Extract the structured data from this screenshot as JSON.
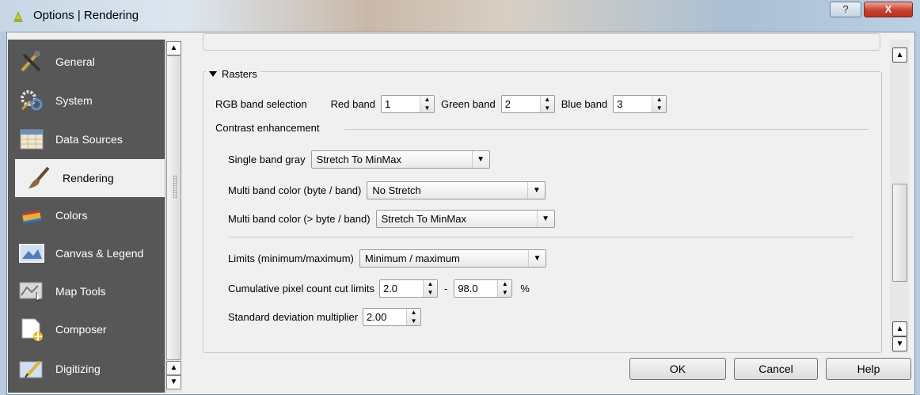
{
  "window": {
    "title": "Options | Rendering",
    "help_glyph": "?",
    "close_glyph": "X"
  },
  "sidebar": {
    "items": [
      {
        "label": "General",
        "icon": "tools-icon"
      },
      {
        "label": "System",
        "icon": "gears-icon"
      },
      {
        "label": "Data Sources",
        "icon": "table-icon"
      },
      {
        "label": "Rendering",
        "icon": "brush-icon",
        "active": true
      },
      {
        "label": "Colors",
        "icon": "paint-icon"
      },
      {
        "label": "Canvas & Legend",
        "icon": "canvas-icon"
      },
      {
        "label": "Map Tools",
        "icon": "map-tools-icon"
      },
      {
        "label": "Composer",
        "icon": "composer-icon"
      },
      {
        "label": "Digitizing",
        "icon": "digitizing-icon"
      }
    ]
  },
  "rasters": {
    "section_title": "Rasters",
    "rgb_label": "RGB band selection",
    "red_label": "Red band",
    "red_value": "1",
    "green_label": "Green band",
    "green_value": "2",
    "blue_label": "Blue band",
    "blue_value": "3",
    "contrast_title": "Contrast enhancement",
    "single_band_label": "Single band gray",
    "single_band_value": "Stretch To MinMax",
    "multi_byte_label": "Multi band color (byte / band)",
    "multi_byte_value": "No Stretch",
    "multi_gt_label": "Multi band color (> byte / band)",
    "multi_gt_value": "Stretch To MinMax",
    "limits_label": "Limits (minimum/maximum)",
    "limits_value": "Minimum / maximum",
    "cumulative_label": "Cumulative pixel count cut limits",
    "cumulative_min": "2.0",
    "cumulative_sep": "-",
    "cumulative_max": "98.0",
    "cumulative_unit": "%",
    "stddev_label": "Standard deviation multiplier",
    "stddev_value": "2.00"
  },
  "buttons": {
    "ok": "OK",
    "cancel": "Cancel",
    "help": "Help"
  }
}
